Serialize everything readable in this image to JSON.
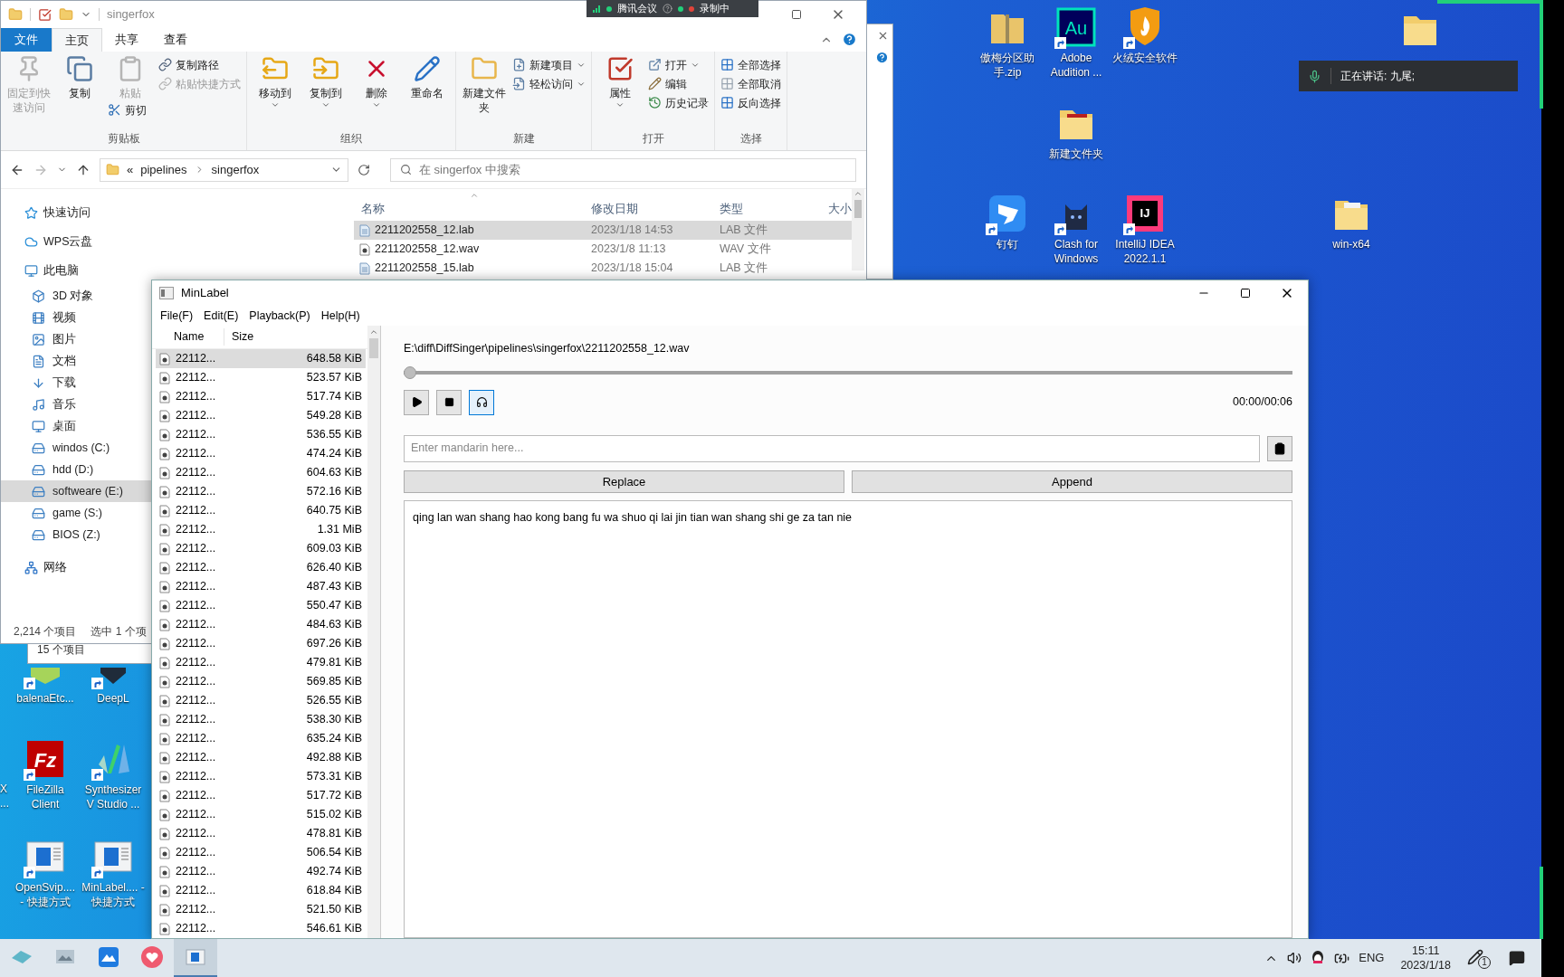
{
  "desktop": {
    "icons": [
      {
        "label": "傲梅分区助手.zip",
        "kind": "zip",
        "shortcut": false
      },
      {
        "label": "Adobe Audition ...",
        "kind": "au",
        "logo_text": "Au",
        "shortcut": true
      },
      {
        "label": "火绒安全软件",
        "kind": "shield",
        "shortcut": true
      },
      {
        "kind": "folder",
        "shortcut": false
      },
      {
        "label": "新建文件夹",
        "kind": "folder_red",
        "shortcut": false
      },
      {
        "label": "钉钉",
        "kind": "dingtalk",
        "shortcut": true
      },
      {
        "label": "Clash for Windows",
        "kind": "cat",
        "shortcut": true
      },
      {
        "label": "IntelliJ IDEA 2022.1.1",
        "kind": "ij",
        "logo_text": "IJ",
        "shortcut": true
      },
      {
        "label": "win-x64",
        "kind": "doc_folder",
        "shortcut": false
      },
      {
        "label": "balenaEtc...",
        "kind": "balena",
        "shortcut": true
      },
      {
        "label": "DeepL",
        "kind": "deepl",
        "shortcut": true
      },
      {
        "label": "FileZilla Client",
        "kind": "filezilla",
        "logo_text": "Fz",
        "shortcut": true
      },
      {
        "label": "Synthesizer V Studio ...",
        "kind": "synth",
        "shortcut": true
      },
      {
        "label": "OpenSvip.... - 快捷方式",
        "kind": "app",
        "shortcut": true
      },
      {
        "label": "MinLabel.... - 快捷方式",
        "kind": "app",
        "shortcut": true
      }
    ],
    "cut_label": "X\n...",
    "toast": "正在讲话: 九尾;"
  },
  "back_window": {
    "status": "15 个项目"
  },
  "meeting": {
    "app": "腾讯会议",
    "status": "录制中"
  },
  "explorer": {
    "title": "singerfox",
    "file_tab": "文件",
    "tabs": [
      {
        "label": "主页",
        "selected": true
      },
      {
        "label": "共享",
        "selected": false
      },
      {
        "label": "查看",
        "selected": false
      }
    ],
    "groups": [
      {
        "label": "剪贴板",
        "columns": [
          [
            {
              "kind": "large",
              "label": "固定到快速访问",
              "disabled": true,
              "has_menu": false
            }
          ],
          [
            {
              "kind": "large",
              "label": "复制",
              "disabled": false,
              "has_menu": false
            }
          ],
          [
            {
              "kind": "large",
              "label": "粘贴",
              "disabled": true,
              "has_menu": false
            },
            {
              "kind": "small",
              "label": "剪切",
              "disabled": false,
              "has_menu": false
            }
          ],
          [
            {
              "kind": "small",
              "label": "复制路径",
              "disabled": false,
              "has_menu": false
            },
            {
              "kind": "small",
              "label": "粘贴快捷方式",
              "disabled": true,
              "has_menu": false
            }
          ]
        ]
      },
      {
        "label": "组织",
        "columns": [
          [
            {
              "kind": "large",
              "label": "移动到",
              "disabled": false,
              "has_menu": true
            }
          ],
          [
            {
              "kind": "large",
              "label": "复制到",
              "disabled": false,
              "has_menu": true
            }
          ],
          [
            {
              "kind": "large",
              "label": "删除",
              "disabled": false,
              "has_menu": true
            }
          ],
          [
            {
              "kind": "large",
              "label": "重命名",
              "disabled": false,
              "has_menu": false
            }
          ]
        ]
      },
      {
        "label": "新建",
        "columns": [
          [
            {
              "kind": "large",
              "label": "新建文件夹",
              "disabled": false,
              "has_menu": false
            }
          ],
          [
            {
              "kind": "small",
              "label": "新建项目",
              "disabled": false,
              "has_menu": true
            },
            {
              "kind": "small",
              "label": "轻松访问",
              "disabled": false,
              "has_menu": true
            }
          ]
        ]
      },
      {
        "label": "打开",
        "columns": [
          [
            {
              "kind": "large",
              "label": "属性",
              "disabled": false,
              "has_menu": true
            }
          ],
          [
            {
              "kind": "small",
              "label": "打开",
              "disabled": false,
              "has_menu": true
            },
            {
              "kind": "small",
              "label": "编辑",
              "disabled": false,
              "has_menu": false
            },
            {
              "kind": "small",
              "label": "历史记录",
              "disabled": false,
              "has_menu": false
            }
          ]
        ]
      },
      {
        "label": "选择",
        "columns": [
          [
            {
              "kind": "small",
              "label": "全部选择",
              "disabled": false,
              "has_menu": false
            },
            {
              "kind": "small",
              "label": "全部取消",
              "disabled": false,
              "has_menu": false
            },
            {
              "kind": "small",
              "label": "反向选择",
              "disabled": false,
              "has_menu": false
            }
          ]
        ]
      }
    ],
    "address": {
      "overflow": "«",
      "parts": [
        "pipelines",
        "singerfox"
      ]
    },
    "search": {
      "placeholder": "在 singerfox 中搜索"
    },
    "nav": [
      {
        "label": "快速访问",
        "selected": false
      },
      {
        "label": "WPS云盘",
        "selected": false
      },
      {
        "label": "此电脑",
        "selected": false,
        "children": [
          {
            "label": "3D 对象",
            "selected": false
          },
          {
            "label": "视频",
            "selected": false
          },
          {
            "label": "图片",
            "selected": false
          },
          {
            "label": "文档",
            "selected": false
          },
          {
            "label": "下载",
            "selected": false
          },
          {
            "label": "音乐",
            "selected": false
          },
          {
            "label": "桌面",
            "selected": false
          },
          {
            "label": "windos (C:)",
            "selected": false
          },
          {
            "label": "hdd (D:)",
            "selected": false
          },
          {
            "label": "softweare (E:)",
            "selected": true
          },
          {
            "label": "game (S:)",
            "selected": false
          },
          {
            "label": "BIOS (Z:)",
            "selected": false
          }
        ]
      },
      {
        "label": "网络",
        "selected": false
      }
    ],
    "columns": [
      "名称",
      "修改日期",
      "类型",
      "大小"
    ],
    "files": [
      {
        "name": "2211202558_12.lab",
        "date": "2023/1/18 14:53",
        "type": "LAB 文件",
        "kind": "lab",
        "selected": true
      },
      {
        "name": "2211202558_12.wav",
        "date": "2023/1/8 11:13",
        "type": "WAV 文件",
        "kind": "wav",
        "selected": false
      },
      {
        "name": "2211202558_15.lab",
        "date": "2023/1/18 15:04",
        "type": "LAB 文件",
        "kind": "lab",
        "selected": false
      }
    ],
    "status": [
      "2,214 个项目",
      "选中 1 个项"
    ]
  },
  "minlabel": {
    "title": "MinLabel",
    "menu": [
      "File(F)",
      "Edit(E)",
      "Playback(P)",
      "Help(H)"
    ],
    "columns": [
      "Name",
      "Size"
    ],
    "rows": [
      {
        "name": "22112...",
        "size": "648.58 KiB",
        "selected": true
      },
      {
        "name": "22112...",
        "size": "523.57 KiB",
        "selected": false
      },
      {
        "name": "22112...",
        "size": "517.74 KiB",
        "selected": false
      },
      {
        "name": "22112...",
        "size": "549.28 KiB",
        "selected": false
      },
      {
        "name": "22112...",
        "size": "536.55 KiB",
        "selected": false
      },
      {
        "name": "22112...",
        "size": "474.24 KiB",
        "selected": false
      },
      {
        "name": "22112...",
        "size": "604.63 KiB",
        "selected": false
      },
      {
        "name": "22112...",
        "size": "572.16 KiB",
        "selected": false
      },
      {
        "name": "22112...",
        "size": "640.75 KiB",
        "selected": false
      },
      {
        "name": "22112...",
        "size": "1.31 MiB",
        "selected": false
      },
      {
        "name": "22112...",
        "size": "609.03 KiB",
        "selected": false
      },
      {
        "name": "22112...",
        "size": "626.40 KiB",
        "selected": false
      },
      {
        "name": "22112...",
        "size": "487.43 KiB",
        "selected": false
      },
      {
        "name": "22112...",
        "size": "550.47 KiB",
        "selected": false
      },
      {
        "name": "22112...",
        "size": "484.63 KiB",
        "selected": false
      },
      {
        "name": "22112...",
        "size": "697.26 KiB",
        "selected": false
      },
      {
        "name": "22112...",
        "size": "479.81 KiB",
        "selected": false
      },
      {
        "name": "22112...",
        "size": "569.85 KiB",
        "selected": false
      },
      {
        "name": "22112...",
        "size": "526.55 KiB",
        "selected": false
      },
      {
        "name": "22112...",
        "size": "538.30 KiB",
        "selected": false
      },
      {
        "name": "22112...",
        "size": "635.24 KiB",
        "selected": false
      },
      {
        "name": "22112...",
        "size": "492.88 KiB",
        "selected": false
      },
      {
        "name": "22112...",
        "size": "573.31 KiB",
        "selected": false
      },
      {
        "name": "22112...",
        "size": "517.72 KiB",
        "selected": false
      },
      {
        "name": "22112...",
        "size": "515.02 KiB",
        "selected": false
      },
      {
        "name": "22112...",
        "size": "478.81 KiB",
        "selected": false
      },
      {
        "name": "22112...",
        "size": "506.54 KiB",
        "selected": false
      },
      {
        "name": "22112...",
        "size": "492.74 KiB",
        "selected": false
      },
      {
        "name": "22112...",
        "size": "618.84 KiB",
        "selected": false
      },
      {
        "name": "22112...",
        "size": "521.50 KiB",
        "selected": false
      },
      {
        "name": "22112...",
        "size": "546.61 KiB",
        "selected": false
      }
    ],
    "path": "E:\\diff\\DiffSinger\\pipelines\\singerfox\\2211202558_12.wav",
    "progress": {
      "level": 0
    },
    "time": "00:00/00:06",
    "input": {
      "placeholder": "Enter mandarin here..."
    },
    "buttons": [
      "Replace",
      "Append"
    ],
    "text": "qing lan wan shang hao kong bang fu wa shuo qi lai jin tian wan shang shi ge za tan nie"
  },
  "taskbar": {
    "apps": [
      {
        "selected": false
      },
      {
        "selected": false
      },
      {
        "selected": false
      },
      {
        "selected": false
      },
      {
        "selected": true
      }
    ],
    "language": "ENG",
    "time": "15:11",
    "date": "2023/1/18",
    "badge": "1"
  }
}
